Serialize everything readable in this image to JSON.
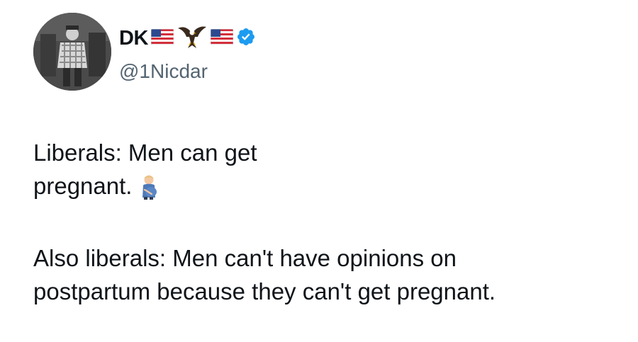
{
  "author": {
    "display_name": "DK",
    "handle": "@1Nicdar",
    "name_decorations": [
      "us-flag-icon",
      "eagle-icon",
      "us-flag-icon",
      "verified-badge-icon"
    ],
    "verified_color": "#1d9bf0"
  },
  "tweet": {
    "paragraph1": {
      "line1": "Liberals: Men can get",
      "line2": "pregnant.",
      "emoji": "pregnant-man-emoji"
    },
    "paragraph2": {
      "line1": "Also liberals: Men can't have opinions on",
      "line2": "postpartum because they can't get pregnant."
    }
  },
  "colors": {
    "text": "#0f1419",
    "secondary_text": "#536471",
    "background": "#ffffff"
  }
}
